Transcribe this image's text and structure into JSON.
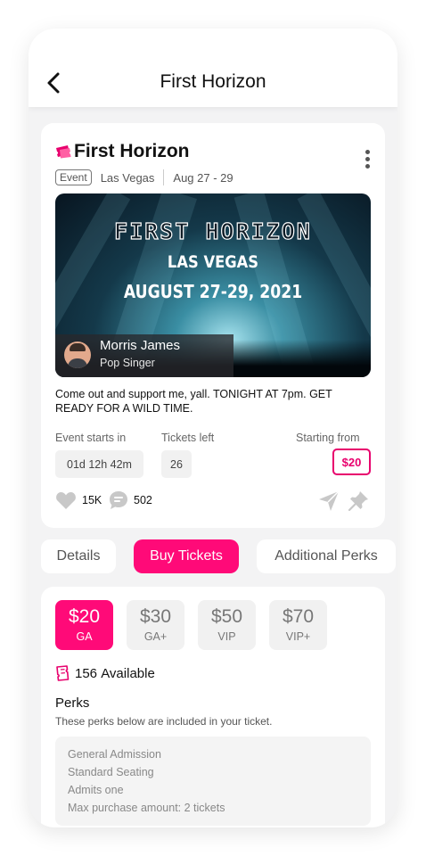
{
  "header": {
    "title": "First Horizon"
  },
  "event": {
    "title": "First Horizon",
    "type_badge": "Event",
    "location": "Las Vegas",
    "dates": "Aug 27 - 29",
    "banner": {
      "title": "FIRST HORIZON",
      "city": "LAS VEGAS",
      "dates": "AUGUST 27-29, 2021"
    },
    "performer": {
      "name": "Morris James",
      "role": "Pop Singer"
    },
    "description": "Come out and support me, yall. TONIGHT AT 7pm. GET READY FOR A WILD TIME.",
    "stats": {
      "starts_label": "Event starts in",
      "starts_value": "01d  12h  42m",
      "tickets_label": "Tickets left",
      "tickets_value": "26",
      "from_label": "Starting from",
      "from_value": "$20"
    },
    "likes": "15K",
    "comments": "502"
  },
  "tabs": [
    {
      "label": "Details"
    },
    {
      "label": "Buy Tickets"
    },
    {
      "label": "Additional Perks"
    }
  ],
  "tiers": [
    {
      "price": "$20",
      "name": "GA"
    },
    {
      "price": "$30",
      "name": "GA+"
    },
    {
      "price": "$50",
      "name": "VIP"
    },
    {
      "price": "$70",
      "name": "VIP+"
    }
  ],
  "availability": {
    "count": "156",
    "label": "Available"
  },
  "perks": {
    "title": "Perks",
    "subtitle": "These perks below are included in your ticket.",
    "items": [
      "General Admission",
      "Standard Seating",
      "Admits one",
      "Max purchase amount: 2 tickets"
    ]
  },
  "colors": {
    "accent": "#ff0a78",
    "accent_border": "#e8006d"
  }
}
